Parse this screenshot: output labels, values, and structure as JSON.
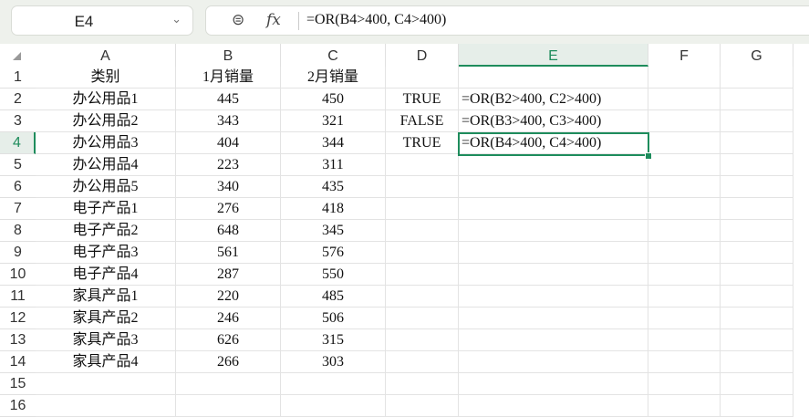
{
  "name_box": "E4",
  "formula_bar": {
    "formula": "=OR(B4>400, C4>400)",
    "fx": "fx"
  },
  "columns": [
    "A",
    "B",
    "C",
    "D",
    "E",
    "F",
    "G"
  ],
  "rows": [
    [
      "类别",
      "1月销量",
      "2月销量",
      "",
      ""
    ],
    [
      "办公用品1",
      "445",
      "450",
      "TRUE",
      "=OR(B2>400, C2>400)"
    ],
    [
      "办公用品2",
      "343",
      "321",
      "FALSE",
      "=OR(B3>400, C3>400)"
    ],
    [
      "办公用品3",
      "404",
      "344",
      "TRUE",
      "=OR(B4>400, C4>400)"
    ],
    [
      "办公用品4",
      "223",
      "311",
      "",
      ""
    ],
    [
      "办公用品5",
      "340",
      "435",
      "",
      ""
    ],
    [
      "电子产品1",
      "276",
      "418",
      "",
      ""
    ],
    [
      "电子产品2",
      "648",
      "345",
      "",
      ""
    ],
    [
      "电子产品3",
      "561",
      "576",
      "",
      ""
    ],
    [
      "电子产品4",
      "287",
      "550",
      "",
      ""
    ],
    [
      "家具产品1",
      "220",
      "485",
      "",
      ""
    ],
    [
      "家具产品2",
      "246",
      "506",
      "",
      ""
    ],
    [
      "家具产品3",
      "626",
      "315",
      "",
      ""
    ],
    [
      "家具产品4",
      "266",
      "303",
      "",
      ""
    ],
    [
      "",
      "",
      "",
      "",
      ""
    ],
    [
      "",
      "",
      "",
      "",
      ""
    ]
  ],
  "selected_cell": {
    "col": "E",
    "row": 4
  },
  "accent": "#1e8c5c"
}
